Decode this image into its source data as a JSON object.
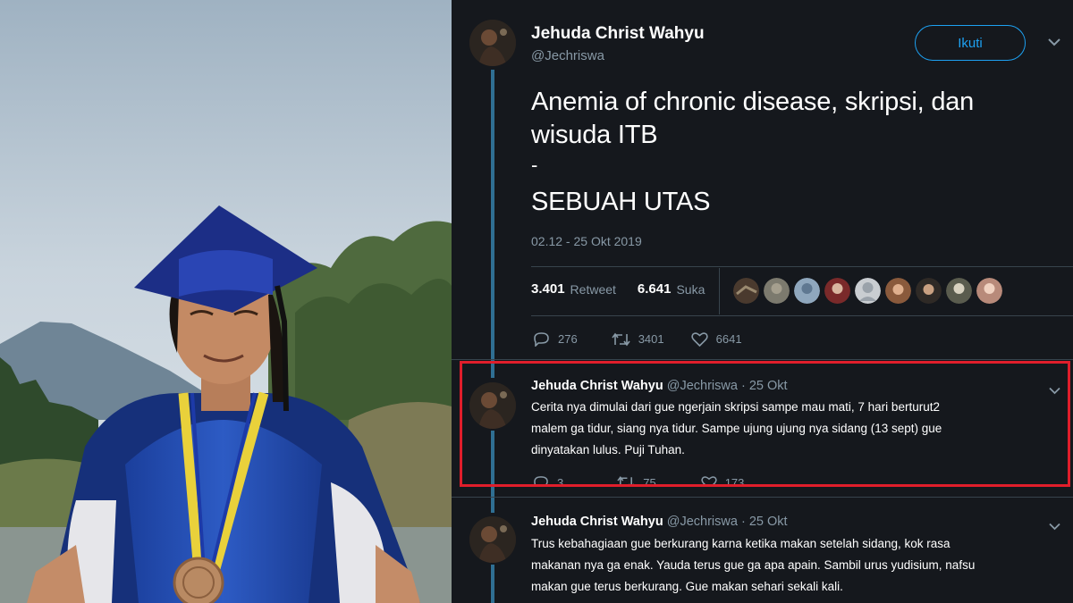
{
  "tweet": {
    "author_name": "Jehuda Christ Wahyu",
    "author_handle": "@Jechriswa",
    "follow_label": "Ikuti",
    "text_line1": "Anemia of chronic disease, skripsi, dan",
    "text_line2": "wisuda ITB",
    "text_line3": "-",
    "text_line4": "SEBUAH UTAS",
    "timestamp": "02.12 - 25 Okt 2019",
    "retweet_count": "3.401",
    "retweet_label": "Retweet",
    "like_count": "6.641",
    "like_label": "Suka",
    "actions": {
      "reply": "276",
      "retweet": "3401",
      "like": "6641"
    }
  },
  "replies": [
    {
      "name": "Jehuda Christ Wahyu",
      "meta": "@Jechriswa · 25 Okt",
      "line1": "Cerita nya dimulai dari gue ngerjain skripsi sampe mau mati, 7 hari berturut2",
      "line2": "malem ga tidur, siang nya tidur. Sampe ujung ujung nya sidang (13 sept) gue",
      "line3": "dinyatakan lulus. Puji Tuhan.",
      "actions": {
        "reply": "3",
        "retweet": "75",
        "like": "173"
      }
    },
    {
      "name": "Jehuda Christ Wahyu",
      "meta": "@Jechriswa · 25 Okt",
      "line1": "Trus kebahagiaan gue berkurang karna ketika makan setelah sidang, kok rasa",
      "line2": "makanan nya ga enak. Yauda terus gue ga apa apain. Sambil urus yudisium, nafsu",
      "line3": "makan gue terus berkurang. Gue makan sehari sekali kali."
    }
  ],
  "icons": {
    "more": "chevron-down-icon",
    "reply": "reply-icon",
    "retweet": "retweet-icon",
    "like": "heart-icon"
  },
  "colors": {
    "accent": "#1da1f2",
    "highlight_box": "#e01e2b",
    "panel_bg": "#15181d",
    "thread_line": "#2f6f93"
  }
}
